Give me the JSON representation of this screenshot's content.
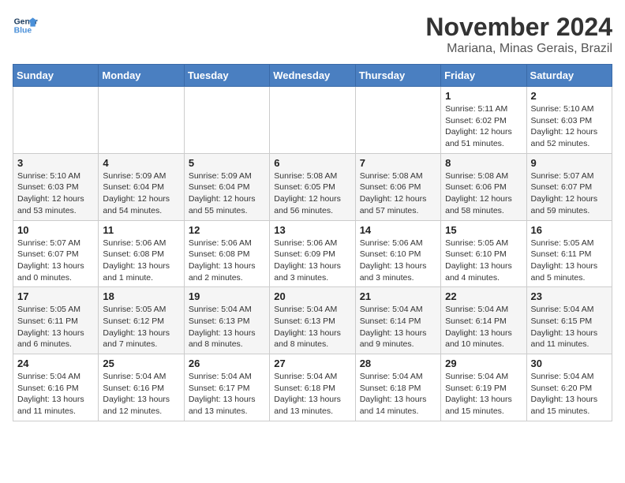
{
  "logo": {
    "line1": "General",
    "line2": "Blue"
  },
  "title": "November 2024",
  "location": "Mariana, Minas Gerais, Brazil",
  "days_of_week": [
    "Sunday",
    "Monday",
    "Tuesday",
    "Wednesday",
    "Thursday",
    "Friday",
    "Saturday"
  ],
  "weeks": [
    [
      {
        "day": "",
        "info": ""
      },
      {
        "day": "",
        "info": ""
      },
      {
        "day": "",
        "info": ""
      },
      {
        "day": "",
        "info": ""
      },
      {
        "day": "",
        "info": ""
      },
      {
        "day": "1",
        "info": "Sunrise: 5:11 AM\nSunset: 6:02 PM\nDaylight: 12 hours\nand 51 minutes."
      },
      {
        "day": "2",
        "info": "Sunrise: 5:10 AM\nSunset: 6:03 PM\nDaylight: 12 hours\nand 52 minutes."
      }
    ],
    [
      {
        "day": "3",
        "info": "Sunrise: 5:10 AM\nSunset: 6:03 PM\nDaylight: 12 hours\nand 53 minutes."
      },
      {
        "day": "4",
        "info": "Sunrise: 5:09 AM\nSunset: 6:04 PM\nDaylight: 12 hours\nand 54 minutes."
      },
      {
        "day": "5",
        "info": "Sunrise: 5:09 AM\nSunset: 6:04 PM\nDaylight: 12 hours\nand 55 minutes."
      },
      {
        "day": "6",
        "info": "Sunrise: 5:08 AM\nSunset: 6:05 PM\nDaylight: 12 hours\nand 56 minutes."
      },
      {
        "day": "7",
        "info": "Sunrise: 5:08 AM\nSunset: 6:06 PM\nDaylight: 12 hours\nand 57 minutes."
      },
      {
        "day": "8",
        "info": "Sunrise: 5:08 AM\nSunset: 6:06 PM\nDaylight: 12 hours\nand 58 minutes."
      },
      {
        "day": "9",
        "info": "Sunrise: 5:07 AM\nSunset: 6:07 PM\nDaylight: 12 hours\nand 59 minutes."
      }
    ],
    [
      {
        "day": "10",
        "info": "Sunrise: 5:07 AM\nSunset: 6:07 PM\nDaylight: 13 hours\nand 0 minutes."
      },
      {
        "day": "11",
        "info": "Sunrise: 5:06 AM\nSunset: 6:08 PM\nDaylight: 13 hours\nand 1 minute."
      },
      {
        "day": "12",
        "info": "Sunrise: 5:06 AM\nSunset: 6:08 PM\nDaylight: 13 hours\nand 2 minutes."
      },
      {
        "day": "13",
        "info": "Sunrise: 5:06 AM\nSunset: 6:09 PM\nDaylight: 13 hours\nand 3 minutes."
      },
      {
        "day": "14",
        "info": "Sunrise: 5:06 AM\nSunset: 6:10 PM\nDaylight: 13 hours\nand 3 minutes."
      },
      {
        "day": "15",
        "info": "Sunrise: 5:05 AM\nSunset: 6:10 PM\nDaylight: 13 hours\nand 4 minutes."
      },
      {
        "day": "16",
        "info": "Sunrise: 5:05 AM\nSunset: 6:11 PM\nDaylight: 13 hours\nand 5 minutes."
      }
    ],
    [
      {
        "day": "17",
        "info": "Sunrise: 5:05 AM\nSunset: 6:11 PM\nDaylight: 13 hours\nand 6 minutes."
      },
      {
        "day": "18",
        "info": "Sunrise: 5:05 AM\nSunset: 6:12 PM\nDaylight: 13 hours\nand 7 minutes."
      },
      {
        "day": "19",
        "info": "Sunrise: 5:04 AM\nSunset: 6:13 PM\nDaylight: 13 hours\nand 8 minutes."
      },
      {
        "day": "20",
        "info": "Sunrise: 5:04 AM\nSunset: 6:13 PM\nDaylight: 13 hours\nand 8 minutes."
      },
      {
        "day": "21",
        "info": "Sunrise: 5:04 AM\nSunset: 6:14 PM\nDaylight: 13 hours\nand 9 minutes."
      },
      {
        "day": "22",
        "info": "Sunrise: 5:04 AM\nSunset: 6:14 PM\nDaylight: 13 hours\nand 10 minutes."
      },
      {
        "day": "23",
        "info": "Sunrise: 5:04 AM\nSunset: 6:15 PM\nDaylight: 13 hours\nand 11 minutes."
      }
    ],
    [
      {
        "day": "24",
        "info": "Sunrise: 5:04 AM\nSunset: 6:16 PM\nDaylight: 13 hours\nand 11 minutes."
      },
      {
        "day": "25",
        "info": "Sunrise: 5:04 AM\nSunset: 6:16 PM\nDaylight: 13 hours\nand 12 minutes."
      },
      {
        "day": "26",
        "info": "Sunrise: 5:04 AM\nSunset: 6:17 PM\nDaylight: 13 hours\nand 13 minutes."
      },
      {
        "day": "27",
        "info": "Sunrise: 5:04 AM\nSunset: 6:18 PM\nDaylight: 13 hours\nand 13 minutes."
      },
      {
        "day": "28",
        "info": "Sunrise: 5:04 AM\nSunset: 6:18 PM\nDaylight: 13 hours\nand 14 minutes."
      },
      {
        "day": "29",
        "info": "Sunrise: 5:04 AM\nSunset: 6:19 PM\nDaylight: 13 hours\nand 15 minutes."
      },
      {
        "day": "30",
        "info": "Sunrise: 5:04 AM\nSunset: 6:20 PM\nDaylight: 13 hours\nand 15 minutes."
      }
    ]
  ]
}
